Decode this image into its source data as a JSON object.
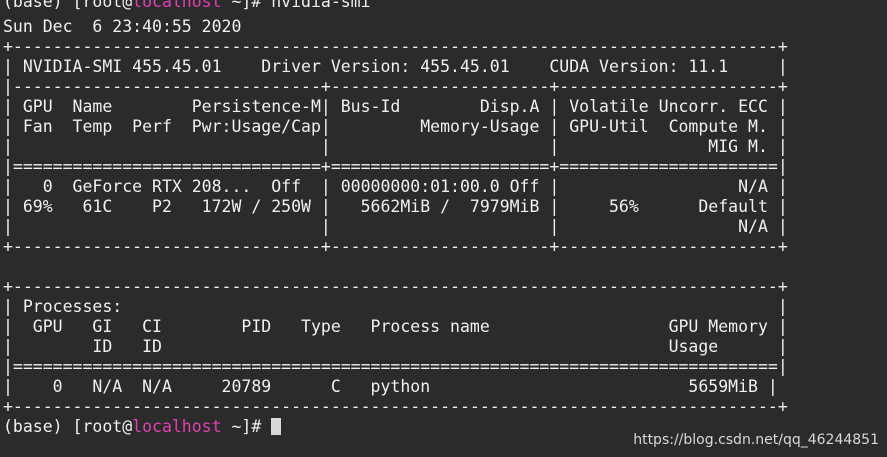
{
  "terminal": {
    "prompt_top": {
      "prefix": "(base) [root@",
      "host": "localhost",
      "suffix": " ~]# nvidia-smi"
    },
    "datetime": "Sun Dec  6 23:40:55 2020",
    "lines": [
      "+-----------------------------------------------------------------------------+",
      "| NVIDIA-SMI 455.45.01    Driver Version: 455.45.01    CUDA Version: 11.1     |",
      "|-------------------------------+----------------------+----------------------+",
      "| GPU  Name        Persistence-M| Bus-Id        Disp.A | Volatile Uncorr. ECC |",
      "| Fan  Temp  Perf  Pwr:Usage/Cap|         Memory-Usage | GPU-Util  Compute M. |",
      "|                               |                      |               MIG M. |",
      "|===============================+======================+======================|",
      "|   0  GeForce RTX 208...  Off  | 00000000:01:00.0 Off |                  N/A |",
      "| 69%   61C    P2   172W / 250W |   5662MiB /  7979MiB |     56%      Default |",
      "|                               |                      |                  N/A |",
      "+-------------------------------+----------------------+----------------------+",
      "",
      "+-----------------------------------------------------------------------------+",
      "| Processes:                                                                  |",
      "|  GPU   GI   CI        PID   Type   Process name                  GPU Memory |",
      "|        ID   ID                                                   Usage      |",
      "|=============================================================================|",
      "|    0   N/A  N/A     20789      C   python                          5659MiB |",
      "+-----------------------------------------------------------------------------+"
    ],
    "prompt_bottom": {
      "prefix": "(base) [root@",
      "host": "localhost",
      "suffix": " ~]# "
    }
  },
  "watermark": "https://blog.csdn.net/qq_46244851",
  "colors": {
    "background": "#2b2b2b",
    "text": "#f0f0f0",
    "host": "#e040b0"
  }
}
